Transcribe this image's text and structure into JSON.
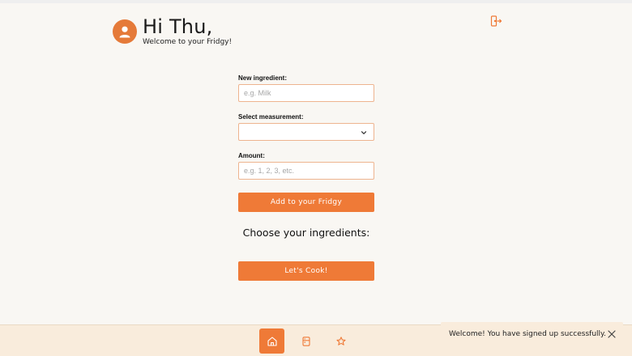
{
  "header": {
    "greeting": "Hi Thu,",
    "subtitle": "Welcome to your Fridgy!",
    "avatar_icon": "user-icon",
    "logout_icon": "logout-icon"
  },
  "form": {
    "ingredient_label": "New ingredient:",
    "ingredient_placeholder": "e.g. Milk",
    "ingredient_value": "",
    "measurement_label": "Select measurement:",
    "measurement_selected": "",
    "amount_label": "Amount:",
    "amount_placeholder": "e.g. 1, 2, 3, etc.",
    "amount_value": "",
    "add_button": "Add to your Fridgy"
  },
  "ingredients": {
    "heading": "Choose your ingredients:",
    "cook_button": "Let's Cook!"
  },
  "bottom_nav": {
    "items": [
      {
        "icon": "home-icon",
        "active": true
      },
      {
        "icon": "fridge-icon",
        "active": false
      },
      {
        "icon": "star-icon",
        "active": false
      }
    ]
  },
  "toast": {
    "message": "Welcome! You have signed up successfully.",
    "close_icon": "close-icon"
  },
  "colors": {
    "accent": "#ef7a37",
    "background": "#f9f7f3",
    "nav_background": "#f9ecdc"
  }
}
